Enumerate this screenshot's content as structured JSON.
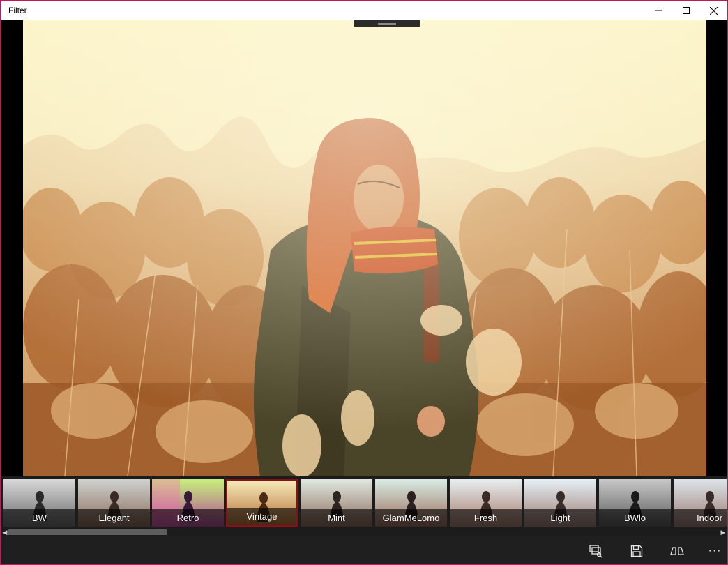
{
  "window": {
    "title": "Filter",
    "accent_border": "#c2185b"
  },
  "photo": {
    "subject": "woman-in-reed-field",
    "tint": "vintage-warm"
  },
  "filters": {
    "selected": "Vintage",
    "items": [
      {
        "label": "BW",
        "tone": "bw"
      },
      {
        "label": "Elegant",
        "tone": "elegant"
      },
      {
        "label": "Retro",
        "tone": "retro"
      },
      {
        "label": "Vintage",
        "tone": "vintage"
      },
      {
        "label": "Mint",
        "tone": "mint"
      },
      {
        "label": "GlamMeLomo",
        "tone": "lomo"
      },
      {
        "label": "Fresh",
        "tone": "fresh"
      },
      {
        "label": "Light",
        "tone": "light"
      },
      {
        "label": "BWlo",
        "tone": "bwlo"
      },
      {
        "label": "Indoor",
        "tone": "indoor"
      }
    ]
  },
  "scrollbar": {
    "position": 0.0
  },
  "commands": {
    "more_label": "···",
    "icons": [
      "compare-icon",
      "save-icon",
      "split-view-icon"
    ]
  },
  "colors": {
    "selection_border": "#8b0f14",
    "strip_bg": "#1c1c1c",
    "command_bar_bg": "#1f1f1f"
  }
}
